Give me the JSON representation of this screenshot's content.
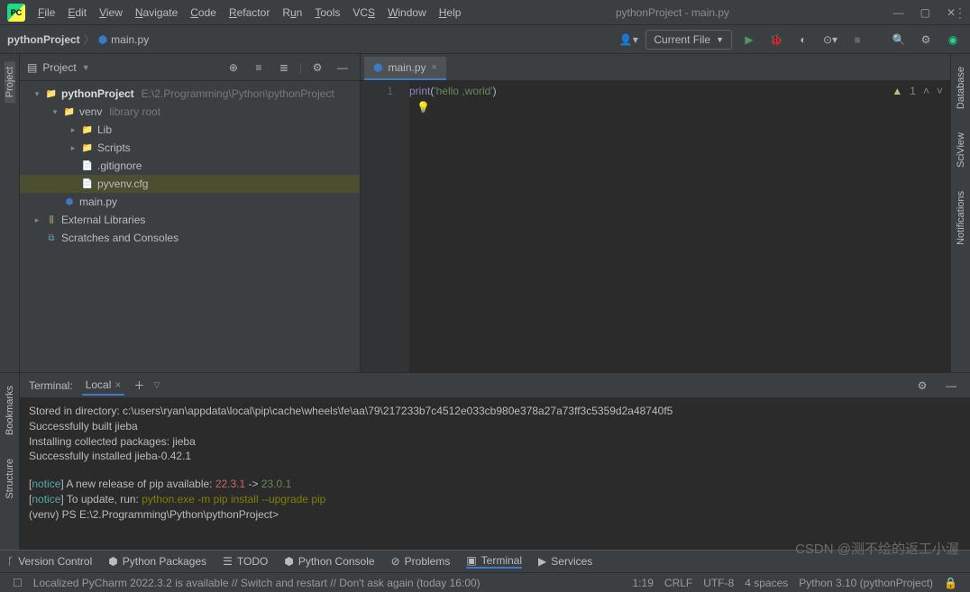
{
  "window": {
    "title": "pythonProject - main.py"
  },
  "menu": [
    "File",
    "Edit",
    "View",
    "Navigate",
    "Code",
    "Refactor",
    "Run",
    "Tools",
    "VCS",
    "Window",
    "Help"
  ],
  "breadcrumb": {
    "root": "pythonProject",
    "file": "main.py"
  },
  "runconfig": {
    "label": "Current File"
  },
  "project_panel": {
    "title": "Project"
  },
  "tree": {
    "root": {
      "name": "pythonProject",
      "path": "E:\\2.Programming\\Python\\pythonProject"
    },
    "venv": {
      "name": "venv",
      "hint": "library root"
    },
    "lib": "Lib",
    "scripts": "Scripts",
    "gitignore": ".gitignore",
    "pyvenv": "pyvenv.cfg",
    "mainpy": "main.py",
    "ext": "External Libraries",
    "scratch": "Scratches and Consoles"
  },
  "editor": {
    "tab": "main.py",
    "lineno": "1",
    "code": {
      "fn": "print",
      "open": "(",
      "str": "'hello ,world'",
      "close": ")"
    },
    "warn_count": "1"
  },
  "terminal": {
    "title": "Terminal:",
    "tab": "Local",
    "lines": {
      "l1": "Stored in directory: c:\\users\\ryan\\appdata\\local\\pip\\cache\\wheels\\fe\\aa\\79\\217233b7c4512e033cb980e378a27a73ff3c5359d2a48740f5",
      "l2": "Successfully built jieba",
      "l3": "Installing collected packages: jieba",
      "l4": "Successfully installed jieba-0.42.1",
      "n1a": "[",
      "n1b": "notice",
      "n1c": "] A new release of pip available: ",
      "n1d": "22.3.1",
      "n1e": " -> ",
      "n1f": "23.0.1",
      "n2a": "[",
      "n2b": "notice",
      "n2c": "] To update, run: ",
      "n2d": "python.exe -m pip install --upgrade pip",
      "prompt": "(venv) PS E:\\2.Programming\\Python\\pythonProject>"
    }
  },
  "bottom": {
    "vcs": "Version Control",
    "pkg": "Python Packages",
    "todo": "TODO",
    "console": "Python Console",
    "problems": "Problems",
    "terminal": "Terminal",
    "services": "Services"
  },
  "status": {
    "msg": "Localized PyCharm 2022.3.2 is available // Switch and restart // Don't ask again (today 16:00)",
    "pos": "1:19",
    "lf": "CRLF",
    "enc": "UTF-8",
    "indent": "4 spaces",
    "py": "Python 3.10 (pythonProject)"
  },
  "side": {
    "project": "Project",
    "bookmarks": "Bookmarks",
    "structure": "Structure",
    "database": "Database",
    "sciview": "SciView",
    "notif": "Notifications"
  },
  "watermark": "CSDN @测不绘的返工小渥"
}
